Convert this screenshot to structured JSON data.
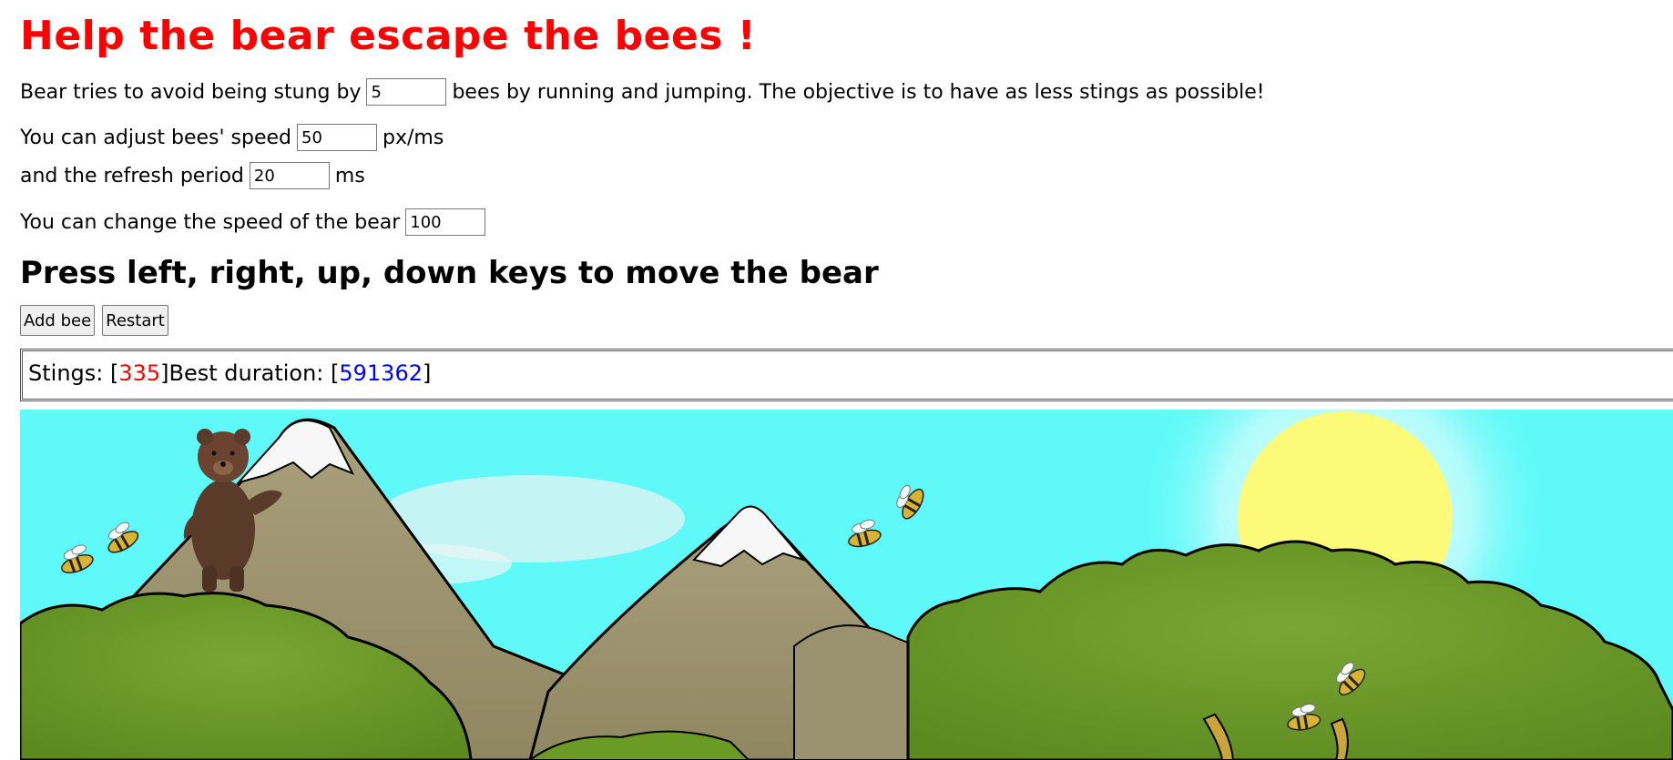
{
  "title": "Help the bear escape the bees !",
  "intro": {
    "before": "Bear tries to avoid being stung by",
    "bees_count": "5",
    "after": "bees by running and jumping. The objective is to have as less stings as possible!"
  },
  "bee_speed": {
    "label": "You can adjust bees' speed",
    "value": "50",
    "unit": "px/ms"
  },
  "refresh": {
    "label": "and the refresh period",
    "value": "20",
    "unit": "ms"
  },
  "bear_speed": {
    "label": "You can change the speed of the bear",
    "value": "100"
  },
  "instructions": "Press left, right, up, down keys to move the bear",
  "buttons": {
    "add_bee": "Add bee",
    "restart": "Restart"
  },
  "score": {
    "stings_label": "Stings: [",
    "stings": "335",
    "best_label": "]Best duration: [",
    "best": "591362",
    "close": "]"
  },
  "colors": {
    "title": "#ff0000",
    "stings": "#ff0000",
    "best": "#0000ff",
    "sky": "#5ff9f9",
    "bush": "#6e9a28",
    "mountain": "#a39670",
    "sun": "#fdfa7a"
  },
  "icons": {
    "bear": "bear-icon",
    "bee": "bee-icon"
  }
}
